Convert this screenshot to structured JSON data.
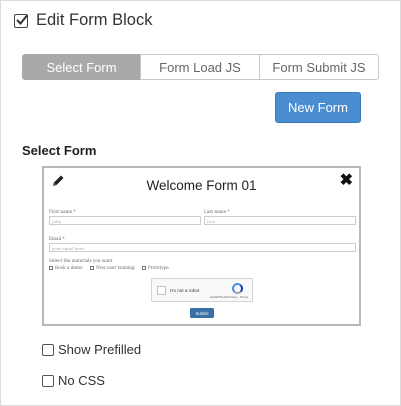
{
  "header": {
    "title": "Edit Form Block",
    "icon": "checkbox-checked-icon"
  },
  "tabs": [
    {
      "label": "Select Form",
      "active": true
    },
    {
      "label": "Form Load JS",
      "active": false
    },
    {
      "label": "Form Submit JS",
      "active": false
    }
  ],
  "new_form_button": {
    "label": "New Form",
    "color": "#4a8ed1"
  },
  "select_form_label": "Select Form",
  "preview": {
    "title": "Welcome Form 01",
    "icons": [
      "pencil-icon",
      "close-icon"
    ],
    "fields": {
      "first_name_label": "First name *",
      "first_name_placeholder": "John",
      "last_name_label": "Last name *",
      "last_name_placeholder": "Doe",
      "email_label": "Email *",
      "email_placeholder": "your email here",
      "materials_label": "Select the materials you want",
      "materials_options": [
        "Book a demo",
        "New user training",
        "Prototype"
      ]
    },
    "captcha": {
      "label": "I'm not a robot",
      "sub": "reCAPTCHA Privacy - Terms"
    },
    "submit_label": "Submit"
  },
  "options": [
    {
      "label": "Show Prefilled",
      "checked": false
    },
    {
      "label": "No CSS",
      "checked": false
    }
  ]
}
